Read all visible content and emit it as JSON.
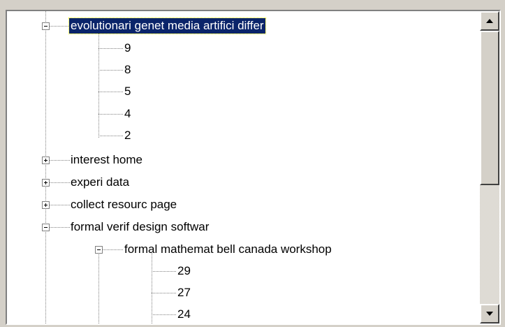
{
  "tree": {
    "nodes": [
      {
        "label": "evolutionari genet media artifici differ",
        "expander": "minus",
        "selected": true
      },
      {
        "label": "9"
      },
      {
        "label": "8"
      },
      {
        "label": "5"
      },
      {
        "label": "4"
      },
      {
        "label": "2"
      },
      {
        "label": "interest home",
        "expander": "plus"
      },
      {
        "label": "experi data",
        "expander": "plus"
      },
      {
        "label": "collect resourc page",
        "expander": "plus"
      },
      {
        "label": "formal verif design softwar",
        "expander": "minus"
      },
      {
        "label": "formal mathemat bell canada workshop",
        "expander": "minus"
      },
      {
        "label": "29"
      },
      {
        "label": "27"
      },
      {
        "label": "24"
      }
    ]
  },
  "scrollbar": {
    "up_icon": "arrow-up-icon",
    "down_icon": "arrow-down-icon",
    "position_fraction": 0.0
  },
  "colors": {
    "selection_bg": "#0a246a",
    "selection_text": "#ffffff",
    "face": "#d4d0c8"
  }
}
